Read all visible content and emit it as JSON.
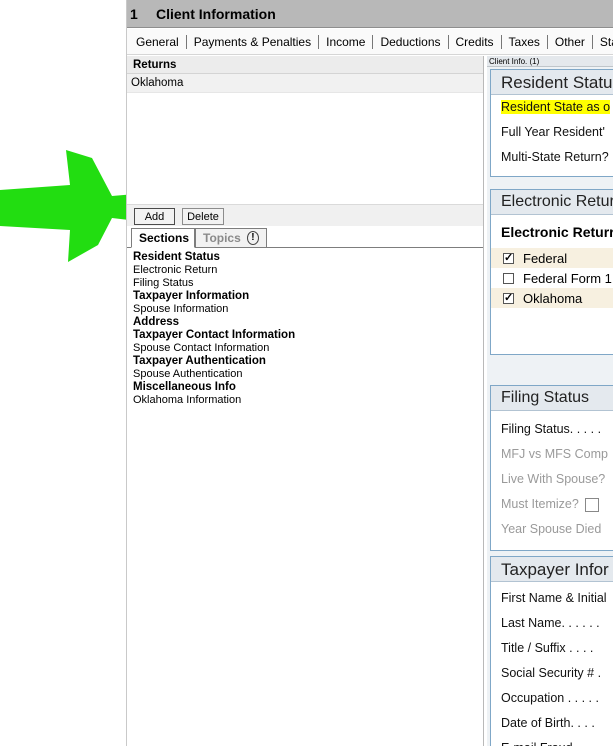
{
  "titlebar": {
    "number": "1",
    "title": "Client Information"
  },
  "tabs": [
    "General",
    "Payments & Penalties",
    "Income",
    "Deductions",
    "Credits",
    "Taxes",
    "Other",
    "State & Lo"
  ],
  "returns": {
    "header": "Returns",
    "items": [
      "Oklahoma"
    ]
  },
  "buttons": {
    "add": "Add",
    "delete": "Delete"
  },
  "section_tabs": {
    "sections": "Sections",
    "topics": "Topics",
    "topics_icon": "!"
  },
  "sections": [
    {
      "label": "Resident Status",
      "bold": true
    },
    {
      "label": "Electronic Return",
      "bold": false
    },
    {
      "label": "Filing Status",
      "bold": false
    },
    {
      "label": "Taxpayer Information",
      "bold": true
    },
    {
      "label": "Spouse Information",
      "bold": false
    },
    {
      "label": "Address",
      "bold": true
    },
    {
      "label": "Taxpayer Contact Information",
      "bold": true
    },
    {
      "label": "Spouse Contact Information",
      "bold": false
    },
    {
      "label": "Taxpayer Authentication",
      "bold": true
    },
    {
      "label": "Spouse Authentication",
      "bold": false
    },
    {
      "label": "Miscellaneous Info",
      "bold": true
    },
    {
      "label": "Oklahoma Information",
      "bold": false
    }
  ],
  "right": {
    "label": "Client Info. (1)",
    "resident": {
      "title": "Resident Statu",
      "rows": [
        "Resident State as o",
        "Full Year Resident'",
        "Multi-State Return?"
      ]
    },
    "electronic": {
      "title": "Electronic Retur",
      "subtitle": "Electronic Returr",
      "checks": [
        {
          "label": "Federal",
          "checked": true,
          "mark": "✓"
        },
        {
          "label": "Federal Form 1",
          "checked": false,
          "mark": ""
        },
        {
          "label": "Oklahoma",
          "checked": true,
          "mark": "✓"
        }
      ]
    },
    "filing": {
      "title": "Filing Status",
      "rows": [
        "Filing Status. . . . .",
        "MFJ vs MFS Comp",
        "Live With Spouse?",
        "Must Itemize?",
        "Year Spouse Died"
      ]
    },
    "taxpayer": {
      "title": "Taxpayer Infor",
      "rows": [
        "First Name & Initial",
        "Last Name. . . . . .",
        "Title / Suffix . . . .",
        "Social Security # .",
        "Occupation . . . . .",
        "Date of Birth. . . .",
        "E-mail Fraud..."
      ]
    }
  },
  "colors": {
    "arrow": "#22dd11",
    "highlight": "#ffff00",
    "panel_border": "#7fa7c7"
  }
}
